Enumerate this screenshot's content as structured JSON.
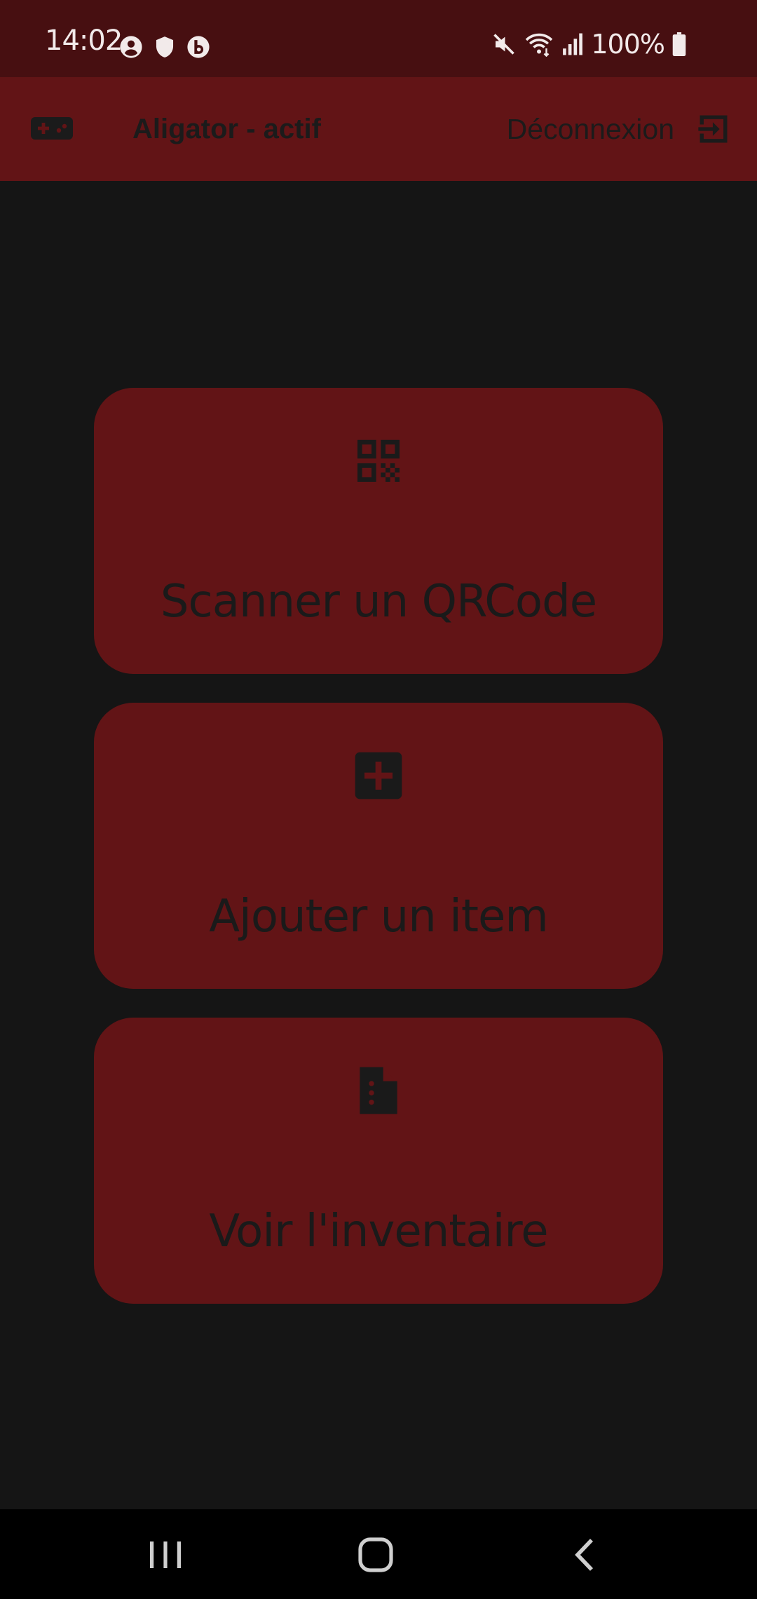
{
  "status_bar": {
    "time": "14:02",
    "battery_percent": "100%",
    "left_icons": [
      "account-circle-icon",
      "shield-icon",
      "b-app-icon"
    ],
    "right_icons": [
      "mute-icon",
      "wifi-icon",
      "signal-icon",
      "battery-icon"
    ]
  },
  "app_bar": {
    "icon": "gamepad-icon",
    "title": "Aligator - actif",
    "logout_label": "Déconnexion",
    "logout_icon": "logout-icon"
  },
  "menu": {
    "items": [
      {
        "label": "Scanner un QRCode",
        "icon": "qrcode-icon"
      },
      {
        "label": "Ajouter un item",
        "icon": "add-box-icon"
      },
      {
        "label": "Voir l'inventaire",
        "icon": "inventory-file-icon"
      }
    ]
  },
  "colors": {
    "status_bar_bg": "#470f11",
    "accent": "#621416",
    "background": "#151515",
    "text_dark": "#1a1a1a",
    "nav_bg": "#000000"
  },
  "nav_bar": {
    "buttons": [
      "recents-icon",
      "home-icon",
      "back-icon"
    ]
  }
}
